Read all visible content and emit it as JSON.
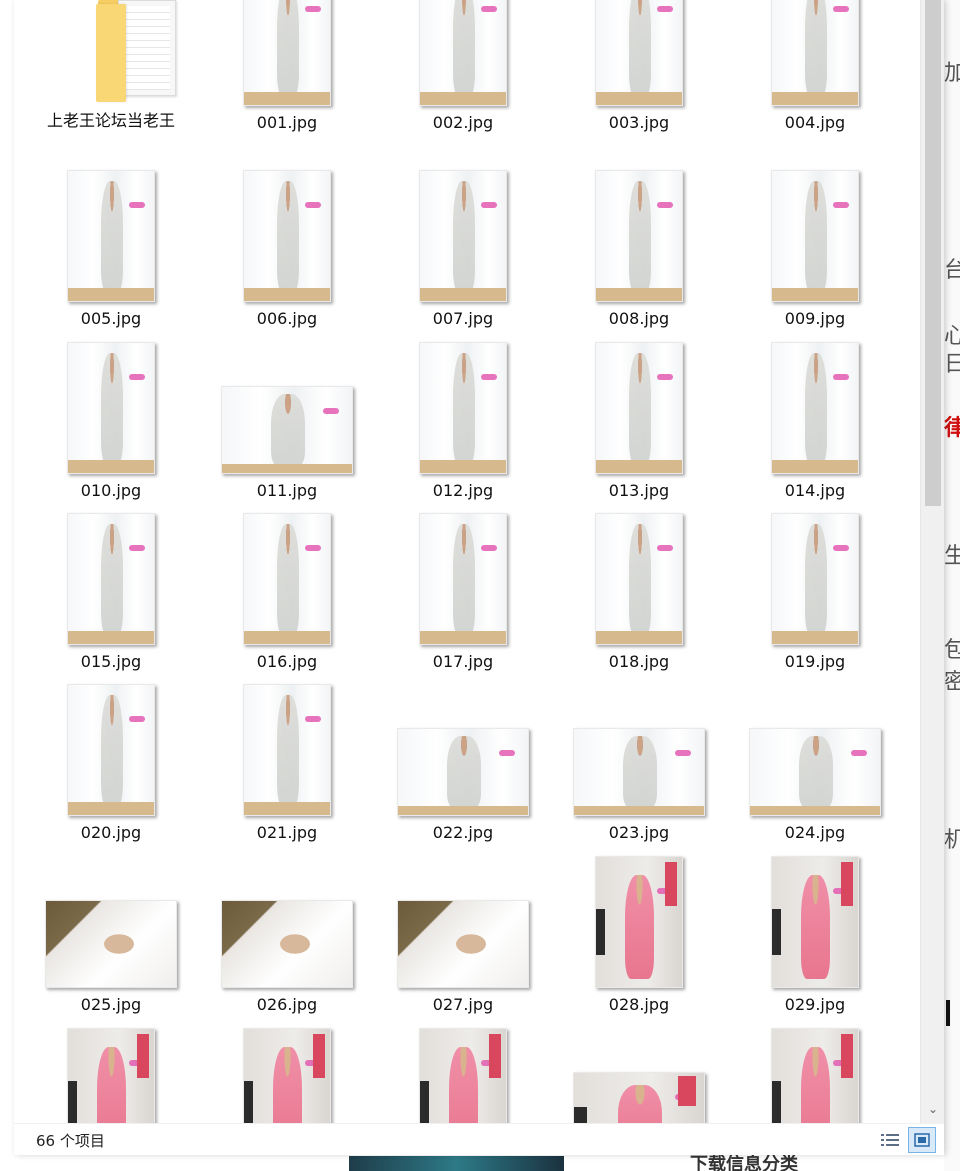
{
  "folder": {
    "name": "上老王论坛当老王"
  },
  "files": [
    {
      "name": "001.jpg",
      "kind": "bright",
      "orient": "portrait"
    },
    {
      "name": "002.jpg",
      "kind": "bright",
      "orient": "portrait"
    },
    {
      "name": "003.jpg",
      "kind": "bright",
      "orient": "portrait"
    },
    {
      "name": "004.jpg",
      "kind": "bright",
      "orient": "portrait"
    },
    {
      "name": "005.jpg",
      "kind": "bright",
      "orient": "portrait"
    },
    {
      "name": "006.jpg",
      "kind": "bright",
      "orient": "portrait"
    },
    {
      "name": "007.jpg",
      "kind": "bright",
      "orient": "portrait"
    },
    {
      "name": "008.jpg",
      "kind": "bright",
      "orient": "portrait"
    },
    {
      "name": "009.jpg",
      "kind": "bright",
      "orient": "portrait"
    },
    {
      "name": "010.jpg",
      "kind": "bright",
      "orient": "portrait"
    },
    {
      "name": "011.jpg",
      "kind": "bright",
      "orient": "landscape"
    },
    {
      "name": "012.jpg",
      "kind": "bright",
      "orient": "portrait"
    },
    {
      "name": "013.jpg",
      "kind": "bright",
      "orient": "portrait"
    },
    {
      "name": "014.jpg",
      "kind": "bright",
      "orient": "portrait"
    },
    {
      "name": "015.jpg",
      "kind": "bright",
      "orient": "portrait"
    },
    {
      "name": "016.jpg",
      "kind": "bright",
      "orient": "portrait"
    },
    {
      "name": "017.jpg",
      "kind": "bright",
      "orient": "portrait"
    },
    {
      "name": "018.jpg",
      "kind": "bright",
      "orient": "portrait"
    },
    {
      "name": "019.jpg",
      "kind": "bright",
      "orient": "portrait"
    },
    {
      "name": "020.jpg",
      "kind": "bright",
      "orient": "portrait"
    },
    {
      "name": "021.jpg",
      "kind": "bright",
      "orient": "portrait"
    },
    {
      "name": "022.jpg",
      "kind": "bright",
      "orient": "landscape"
    },
    {
      "name": "023.jpg",
      "kind": "bright",
      "orient": "landscape"
    },
    {
      "name": "024.jpg",
      "kind": "bright",
      "orient": "landscape"
    },
    {
      "name": "025.jpg",
      "kind": "bed",
      "orient": "landscape"
    },
    {
      "name": "026.jpg",
      "kind": "bed",
      "orient": "landscape"
    },
    {
      "name": "027.jpg",
      "kind": "bed",
      "orient": "landscape"
    },
    {
      "name": "028.jpg",
      "kind": "pink",
      "orient": "portrait"
    },
    {
      "name": "029.jpg",
      "kind": "pink",
      "orient": "portrait"
    },
    {
      "name": "",
      "kind": "pink",
      "orient": "portrait"
    },
    {
      "name": "",
      "kind": "pink",
      "orient": "portrait"
    },
    {
      "name": "",
      "kind": "pink",
      "orient": "portrait"
    },
    {
      "name": "",
      "kind": "pink",
      "orient": "landscape"
    },
    {
      "name": "",
      "kind": "pink",
      "orient": "portrait"
    }
  ],
  "status": {
    "item_count": "66 个项目"
  },
  "view": {
    "details_icon": "details-view-icon",
    "thumbs_icon": "large-icons-view-icon"
  },
  "background": {
    "frag1": "加",
    "frag2": "台",
    "frag3": "心",
    "frag4": "日",
    "frag5": "律",
    "frag6": "生",
    "frag7": "包",
    "frag8": "密",
    "frag9": "机",
    "bottom_text": "下载信息分类"
  },
  "colors": {
    "folder": "#f8d774",
    "selection": "#d8eafa",
    "accent": "#2a6aa8"
  }
}
